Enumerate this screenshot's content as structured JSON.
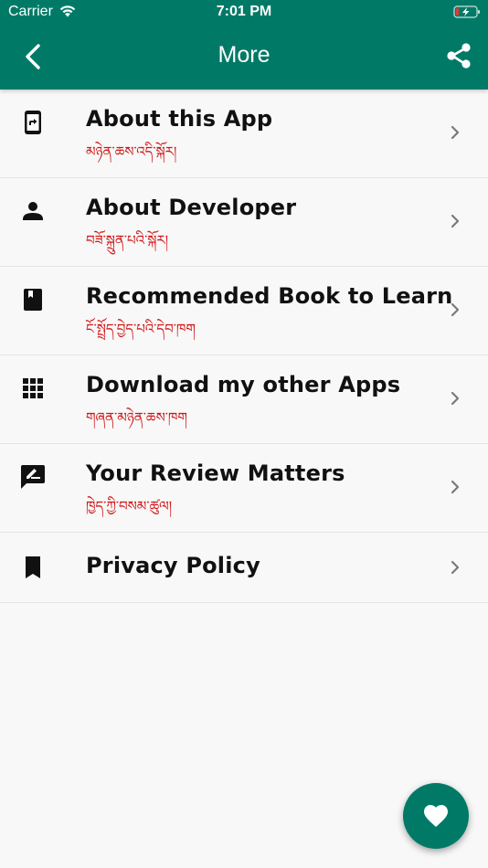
{
  "status_bar": {
    "carrier": "Carrier",
    "time": "7:01 PM",
    "wifi_icon": "wifi-icon",
    "battery_icon": "battery-charging-icon"
  },
  "nav": {
    "title": "More",
    "back_icon": "chevron-left-icon",
    "share_icon": "share-icon",
    "background": "#007a67"
  },
  "menu": {
    "items": [
      {
        "icon": "phone-forward-icon",
        "title": "About this App",
        "subtitle": "མཉེན་ཆས་འདི་སྐོར།"
      },
      {
        "icon": "person-icon",
        "title": "About Developer",
        "subtitle": "བཟོ་སྐྲུན་པའི་སྐོར།"
      },
      {
        "icon": "book-icon",
        "title": "Recommended Book to Learn",
        "subtitle": "ངོ་སྤྲོད་བྱེད་པའི་དེབ་ཁག"
      },
      {
        "icon": "apps-grid-icon",
        "title": "Download my other Apps",
        "subtitle": "གཞན་མཉེན་ཆས་ཁག"
      },
      {
        "icon": "rate-review-icon",
        "title": "Your Review Matters",
        "subtitle": "ཁྱེད་ཀྱི་བསམ་ཚུལ།"
      },
      {
        "icon": "bookmark-icon",
        "title": "Privacy Policy",
        "subtitle": ""
      }
    ],
    "chevron_icon": "chevron-right-icon",
    "subtitle_color": "#d01616"
  },
  "fab": {
    "icon": "heart-icon",
    "color": "#007a67"
  }
}
